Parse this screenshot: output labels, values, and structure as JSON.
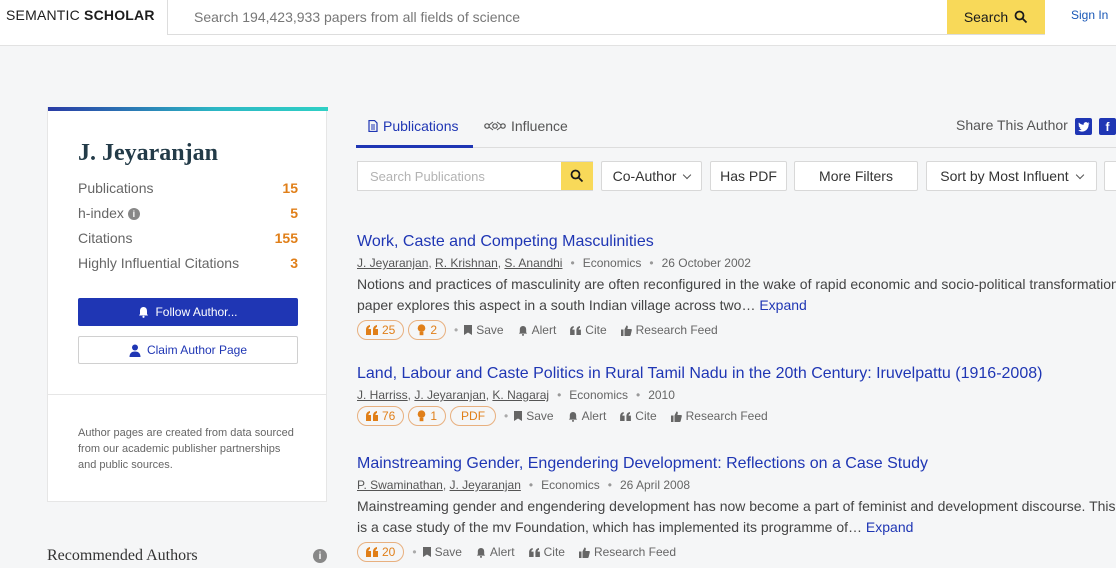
{
  "header": {
    "logo_light": "SEMANTIC",
    "logo_bold": "SCHOLAR",
    "search_placeholder": "Search 194,423,933 papers from all fields of science",
    "search_button": "Search",
    "signin": "Sign In"
  },
  "author": {
    "name": "J. Jeyaranjan",
    "stats": [
      {
        "label": "Publications",
        "value": "15"
      },
      {
        "label": "h-index",
        "value": "5"
      },
      {
        "label": "Citations",
        "value": "155"
      },
      {
        "label": "Highly Influential Citations",
        "value": "3"
      }
    ],
    "follow_button": "Follow Author...",
    "claim_button": "Claim Author Page",
    "note": "Author pages are created from data sourced from our academic publisher partnerships and public sources."
  },
  "recommended": {
    "title": "Recommended Authors"
  },
  "tabs": {
    "publications": "Publications",
    "influence": "Influence",
    "share": "Share This Author"
  },
  "filters": {
    "search_placeholder": "Search Publications",
    "coauthor": "Co-Author",
    "haspdf": "Has PDF",
    "more": "More Filters",
    "sort": "Sort by Most Influent"
  },
  "papers": [
    {
      "title": "Work, Caste and Competing Masculinities",
      "authors": [
        "J. Jeyaranjan",
        "R. Krishnan",
        "S. Anandhi"
      ],
      "field": "Economics",
      "date": "26 October 2002",
      "abstract_line1": "Notions and practices of masculinity are often reconfigured in the wake of rapid economic and socio-political transformation",
      "abstract_line2": "paper explores this aspect in a south Indian village across two…",
      "expand": "Expand",
      "citations": "25",
      "influential": "2",
      "pdf": "",
      "actions": [
        "Save",
        "Alert",
        "Cite",
        "Research Feed"
      ]
    },
    {
      "title": "Land, Labour and Caste Politics in Rural Tamil Nadu in the 20th Century: Iruvelpattu (1916-2008)",
      "authors": [
        "J. Harriss",
        "J. Jeyaranjan",
        "K. Nagaraj"
      ],
      "field": "Economics",
      "date": "2010",
      "abstract_line1": "",
      "abstract_line2": "",
      "expand": "",
      "citations": "76",
      "influential": "1",
      "pdf": "PDF",
      "actions": [
        "Save",
        "Alert",
        "Cite",
        "Research Feed"
      ]
    },
    {
      "title": "Mainstreaming Gender, Engendering Development: Reflections on a Case Study",
      "authors": [
        "P. Swaminathan",
        "J. Jeyaranjan"
      ],
      "field": "Economics",
      "date": "26 April 2008",
      "abstract_line1": "Mainstreaming gender and engendering development has now become a part of feminist and development discourse. This",
      "abstract_line2": "is a case study of the mv Foundation, which has implemented its programme of…",
      "expand": "Expand",
      "citations": "20",
      "influential": "",
      "pdf": "",
      "actions": [
        "Save",
        "Alert",
        "Cite",
        "Research Feed"
      ]
    }
  ],
  "colors": {
    "accent": "#1f36b4",
    "highlight": "#f8d959",
    "stat": "#e07f19"
  }
}
